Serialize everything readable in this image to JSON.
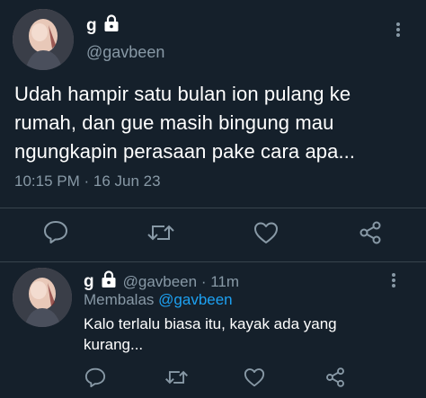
{
  "main_tweet": {
    "name": "g",
    "handle": "@gavbeen",
    "text_line1": "Udah hampir satu bulan ion pulang ke",
    "text_line2": "rumah, dan gue masih bingung mau",
    "text_line3": "ngungkapin perasaan pake cara apa...",
    "timestamp": "10:15 PM · 16 Jun 23",
    "actions": [
      "reply-icon",
      "retweet-icon",
      "like-icon",
      "share-icon"
    ]
  },
  "reply_tweet": {
    "name": "g",
    "handle_time": "@gavbeen · 11m",
    "replying_prefix": "Membalas",
    "replying_to": "@gavbeen",
    "text_line1": "Kalo terlalu biasa itu, kayak ada yang",
    "text_line2": "kurang...",
    "actions": [
      "reply-icon",
      "retweet-icon",
      "like-icon",
      "share-icon"
    ]
  },
  "colors": {
    "background": "#15202b",
    "secondary_text": "#8899a6",
    "link": "#1da1f2",
    "divider": "#38444d"
  }
}
